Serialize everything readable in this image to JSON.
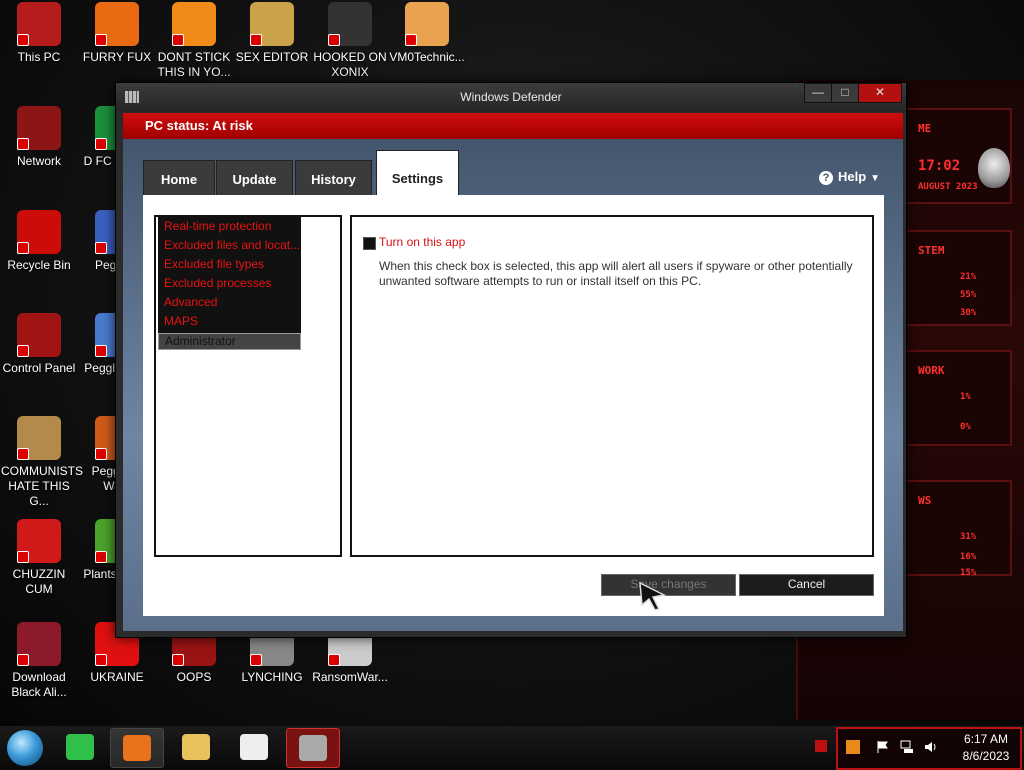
{
  "desktop": {
    "icons": [
      {
        "label": "This PC",
        "color": "#b51d1d"
      },
      {
        "label": "FURRY FUX",
        "color": "#e86b14"
      },
      {
        "label": "DONT STICK THIS IN YO...",
        "color": "#f08a18"
      },
      {
        "label": "SEX EDITOR",
        "color": "#c9a24a"
      },
      {
        "label": "HOOKED ON XONIX",
        "color": "#333333"
      },
      {
        "label": "VM0Technic...",
        "color": "#e8a250"
      },
      {
        "label": "Network",
        "color": "#8c1515"
      },
      {
        "label": "D FC DUMB",
        "color": "#1a8f3c"
      },
      {
        "label": "Recycle Bin",
        "color": "#cc0b0b"
      },
      {
        "label": "Peggle I",
        "color": "#3a5fbf"
      },
      {
        "label": "Control Panel",
        "color": "#a01414"
      },
      {
        "label": "Peggle Delu",
        "color": "#4a7bd0"
      },
      {
        "label": "COMMUNISTS HATE THIS G...",
        "color": "#b38a4a"
      },
      {
        "label": "Peggle of Warc",
        "color": "#d05a1a"
      },
      {
        "label": "CHUZZIN CUM",
        "color": "#d01a1a"
      },
      {
        "label": "Plants Zomb",
        "color": "#4aa32a"
      },
      {
        "label": "Download Black Ali...",
        "color": "#8c1a2a"
      },
      {
        "label": "UKRAINE",
        "color": "#e01010"
      },
      {
        "label": "OOPS",
        "color": "#9a1414"
      },
      {
        "label": "LYNCHING",
        "color": "#888888"
      },
      {
        "label": "RansomWar...",
        "color": "#cccccc"
      }
    ]
  },
  "widget": {
    "panels": [
      "ME",
      "17:02",
      "AUGUST 2023",
      "STEM",
      "21%",
      "55%",
      "30%",
      "WORK",
      "1%",
      "0%",
      "WS",
      "31%",
      "16%",
      "15%"
    ]
  },
  "window": {
    "title": "Windows Defender",
    "controls": {
      "minimize": "—",
      "maximize": "□",
      "close": "✕"
    },
    "status": "PC status: At risk",
    "tabs": [
      {
        "label": "Home",
        "active": false
      },
      {
        "label": "Update",
        "active": false
      },
      {
        "label": "History",
        "active": false
      },
      {
        "label": "Settings",
        "active": true
      }
    ],
    "help": "Help",
    "nav": [
      "Real-time protection",
      "Excluded files and locat...",
      "Excluded file types",
      "Excluded processes",
      "Advanced",
      "MAPS",
      "Administrator"
    ],
    "selected_nav": "Administrator",
    "checkbox_label": "Turn on this app",
    "checkbox_checked": true,
    "description": "When this check box is selected, this app will alert all users if spyware or other potentially unwanted software attempts to run or install itself on this PC.",
    "buttons": {
      "save": "Save changes",
      "cancel": "Cancel"
    }
  },
  "taskbar": {
    "pinned": [
      {
        "name": "notes",
        "color": "#2fbf4a",
        "state": "normal"
      },
      {
        "name": "firefox",
        "color": "#e8731a",
        "state": "active"
      },
      {
        "name": "file-explorer",
        "color": "#e8c25a",
        "state": "normal"
      },
      {
        "name": "7zip",
        "color": "#eeeeee",
        "state": "normal"
      },
      {
        "name": "windows-defender",
        "color": "#aaaaaa",
        "state": "open"
      }
    ],
    "clock": {
      "time": "6:17 AM",
      "date": "8/6/2023"
    }
  }
}
